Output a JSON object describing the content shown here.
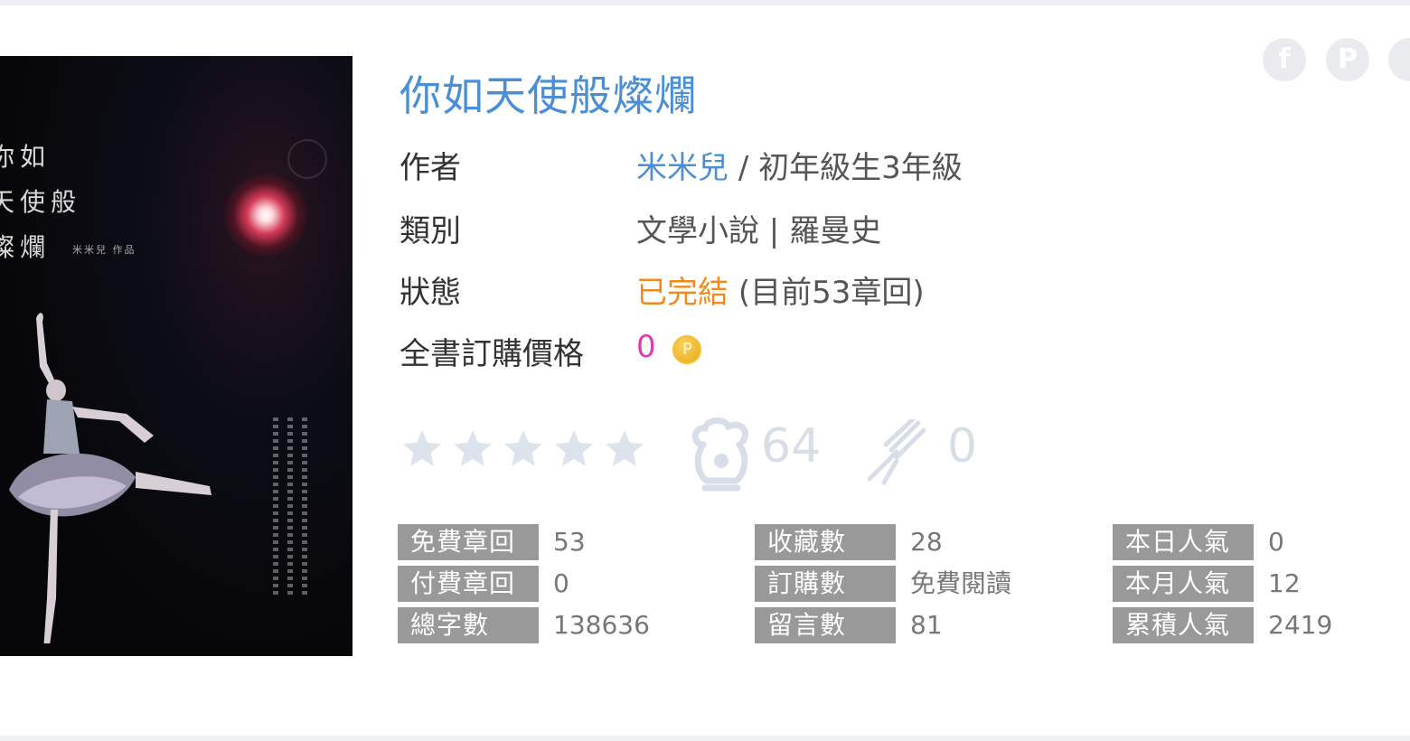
{
  "book": {
    "title": "你如天使般燦爛",
    "cover": {
      "lines": [
        "你如",
        "天使般",
        "燦爛"
      ],
      "byline": "米米兒 作品"
    }
  },
  "info": {
    "author_label": "作者",
    "author_name": "米米兒",
    "author_rest": "/ 初年級生3年級",
    "category_label": "類別",
    "category_value": "文學小說 | 羅曼史",
    "status_label": "狀態",
    "status_value": "已完結",
    "status_extra": "(目前53章回)",
    "price_label": "全書訂購價格",
    "price_value": "0",
    "price_coin": "P"
  },
  "rating": {
    "stars_filled": 0,
    "stars_total": 5,
    "chef_count": "64",
    "fork_count": "0"
  },
  "stats": [
    [
      {
        "label": "免費章回",
        "value": "53"
      },
      {
        "label": "付費章回",
        "value": "0"
      },
      {
        "label": "總字數",
        "value": "138636"
      }
    ],
    [
      {
        "label": "收藏數",
        "value": "28"
      },
      {
        "label": "訂購數",
        "value": "免費閱讀"
      },
      {
        "label": "留言數",
        "value": "81"
      }
    ],
    [
      {
        "label": "本日人氣",
        "value": "0"
      },
      {
        "label": "本月人氣",
        "value": "12"
      },
      {
        "label": "累積人氣",
        "value": "2419"
      }
    ]
  ],
  "share": {
    "facebook": "f",
    "plurk": "P"
  },
  "colors": {
    "title": "#4a8fd6",
    "status": "#f08a1e",
    "price": "#e03ab0",
    "stat_label_bg": "#999999",
    "muted_icons": "#d8dee8"
  }
}
